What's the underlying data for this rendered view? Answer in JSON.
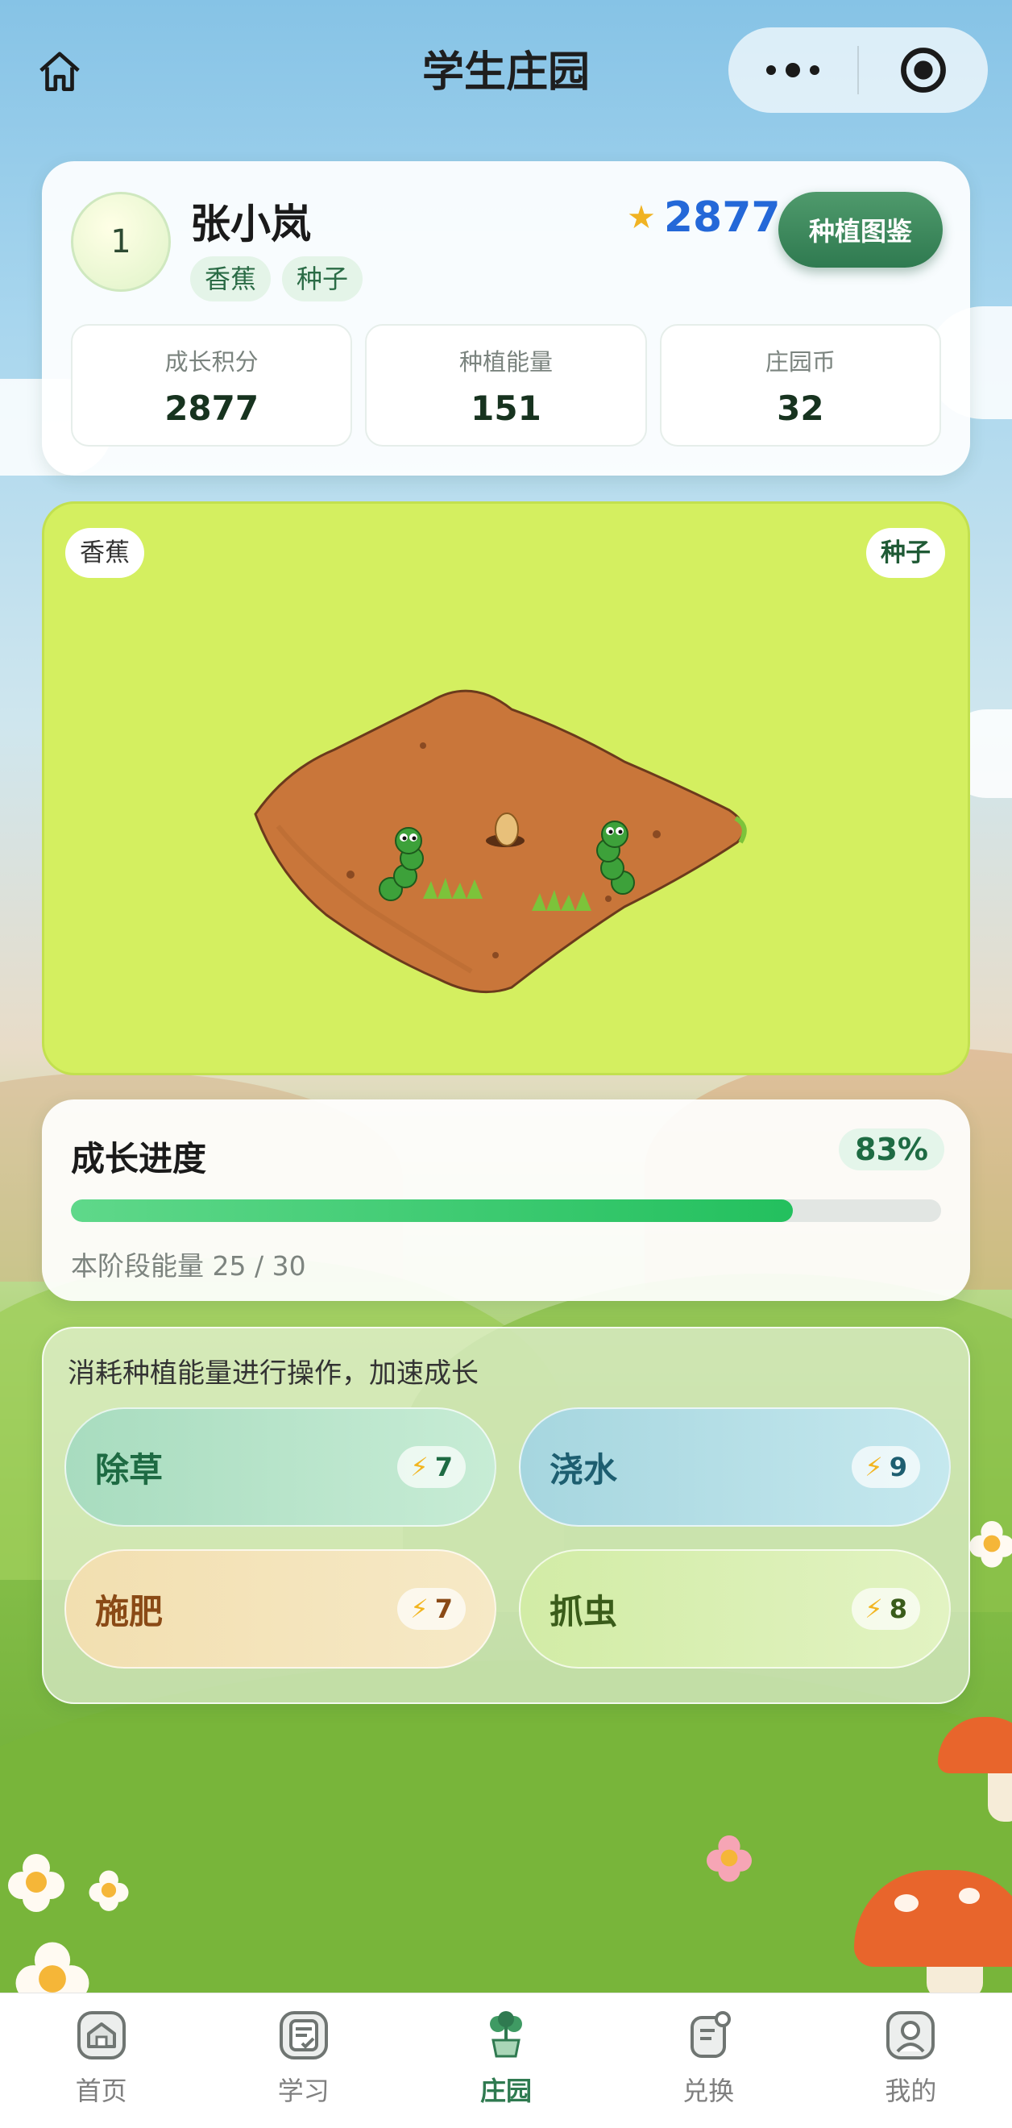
{
  "header": {
    "title": "学生庄园"
  },
  "profile": {
    "level": "1",
    "name": "张小岚",
    "tags": [
      "香蕉",
      "种子"
    ],
    "score": "2877",
    "guide_button": "种植图鉴",
    "stats": [
      {
        "label": "成长积分",
        "value": "2877"
      },
      {
        "label": "种植能量",
        "value": "151"
      },
      {
        "label": "庄园币",
        "value": "32"
      }
    ]
  },
  "field": {
    "crop": "香蕉",
    "stage": "种子"
  },
  "progress": {
    "title": "成长进度",
    "percent_label": "83%",
    "percent": 83,
    "energy_text": "本阶段能量 25 / 30"
  },
  "actions": {
    "hint": "消耗种植能量进行操作，加速成长",
    "items": [
      {
        "label": "除草",
        "cost": "7"
      },
      {
        "label": "浇水",
        "cost": "9"
      },
      {
        "label": "施肥",
        "cost": "7"
      },
      {
        "label": "抓虫",
        "cost": "8"
      }
    ]
  },
  "tabbar": {
    "items": [
      {
        "label": "首页"
      },
      {
        "label": "学习"
      },
      {
        "label": "庄园"
      },
      {
        "label": "兑换"
      },
      {
        "label": "我的"
      }
    ],
    "active": "庄园"
  },
  "colors": {
    "accent": "#2f7a50",
    "score": "#2468d8",
    "progress": "#23c05e",
    "field": "#d4ef60"
  }
}
